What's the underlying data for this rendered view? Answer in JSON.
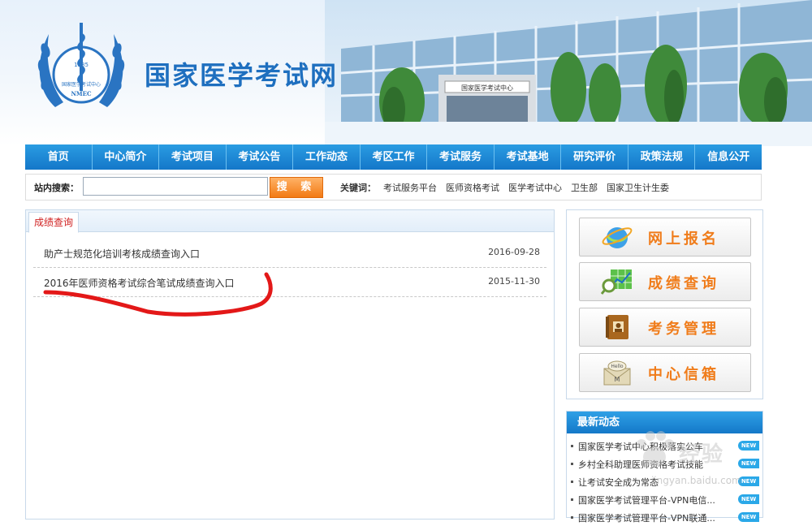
{
  "header": {
    "site_title": "国家医学考试网",
    "logo_year": "1985",
    "logo_org": "国家医学考试中心",
    "logo_abbr": "NMEC",
    "building_sign": "国家医学考试中心"
  },
  "nav": {
    "items": [
      "首页",
      "中心简介",
      "考试项目",
      "考试公告",
      "工作动态",
      "考区工作",
      "考试服务",
      "考试基地",
      "研究评价",
      "政策法规",
      "信息公开"
    ]
  },
  "search": {
    "label": "站内搜索：",
    "value": "",
    "placeholder": "",
    "button_label": "搜 索",
    "keywords_label": "关键词：",
    "keywords": [
      "考试服务平台",
      "医师资格考试",
      "医学考试中心",
      "卫生部",
      "国家卫生计生委"
    ]
  },
  "results": {
    "tab_label": "成绩查询",
    "rows": [
      {
        "title": "助产士规范化培训考核成绩查询入口",
        "date": "2016-09-28"
      },
      {
        "title": "2016年医师资格考试综合笔试成绩查询入口",
        "date": "2015-11-30"
      }
    ]
  },
  "sidebar": {
    "quick_links": [
      {
        "label": "网上报名",
        "icon": "ie-globe-icon"
      },
      {
        "label": "成绩查询",
        "icon": "search-chart-icon"
      },
      {
        "label": "考务管理",
        "icon": "notebook-icon"
      },
      {
        "label": "中心信箱",
        "icon": "mail-icon"
      }
    ],
    "news_title": "最新动态",
    "news": [
      {
        "text": "国家医学考试中心积极落实公车",
        "badge": "NEW"
      },
      {
        "text": "乡村全科助理医师资格考试技能",
        "badge": "NEW"
      },
      {
        "text": "让考试安全成为常态",
        "badge": "NEW"
      },
      {
        "text": "国家医学考试管理平台-VPN电信...",
        "badge": "NEW"
      },
      {
        "text": "国家医学考试管理平台-VPN联通...",
        "badge": "NEW"
      }
    ],
    "watermark_text": "经验",
    "watermark_url": "jingyan.baidu.com"
  },
  "colors": {
    "nav_blue": "#1a86d6",
    "accent_orange": "#f07c1a",
    "tab_red": "#d02020",
    "annotation_red": "#e31818"
  }
}
